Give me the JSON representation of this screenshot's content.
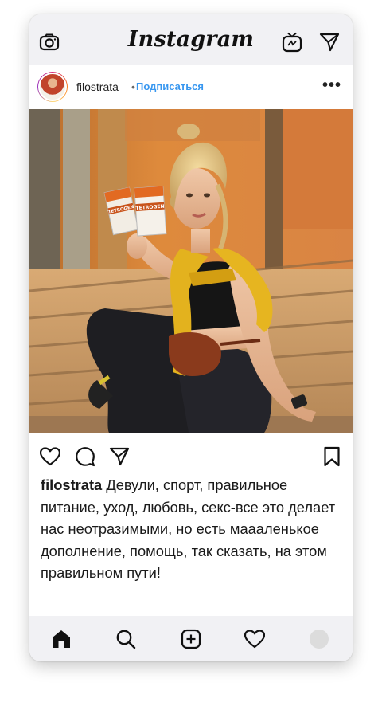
{
  "app": {
    "title": "Instagram"
  },
  "topbar": {
    "icons": [
      "camera-icon",
      "igtv-icon",
      "direct-icon"
    ]
  },
  "post": {
    "username": "filostrata",
    "separator": "•",
    "follow_label": "Подписаться",
    "more_label": "•••",
    "caption_user": "filostrata",
    "caption_text": "Девули, спорт, правильное питание, уход, любовь, секс-все это делает нас неотразимыми, но есть маааленькое дополнение, помощь, так сказать, на этом правильном пути!",
    "product_labels": [
      "TETROGEN",
      "TETROGEN"
    ]
  },
  "actions": {
    "icons": [
      "heart-icon",
      "comment-icon",
      "share-icon",
      "bookmark-icon"
    ]
  },
  "bottombar": {
    "icons": [
      "home-icon",
      "search-icon",
      "add-icon",
      "activity-icon",
      "profile-icon"
    ]
  },
  "colors": {
    "link": "#3897f0",
    "bars": "#f1f1f4",
    "text": "#1a1a1a"
  }
}
